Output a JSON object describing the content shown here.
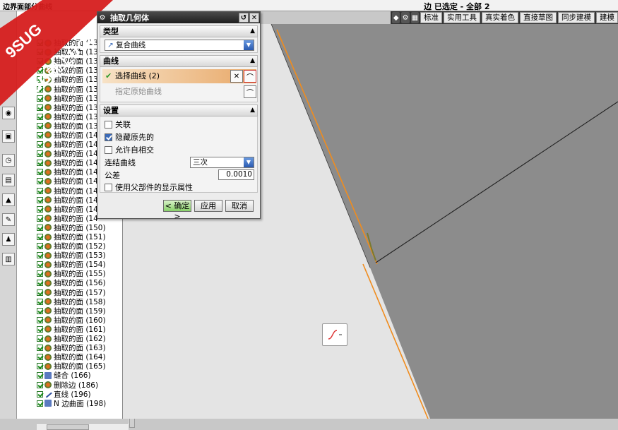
{
  "app": {
    "cut_title": "边界面部分曲线",
    "selection_status": "边 已选定 - 全部 2"
  },
  "toolbar": {
    "items": [
      "标准",
      "实用工具",
      "真实着色",
      "直接草图",
      "同步建模",
      "建模"
    ]
  },
  "watermark": {
    "brand": "9SUG",
    "slogan": "学UG就上UG网",
    "colors": {
      "ribbon": "#d61e1e",
      "text": "#ffffff"
    }
  },
  "navigator": {
    "rows": [
      {
        "label": "抽取的面 (13",
        "icon": "extract-face-icon"
      },
      {
        "label": "抽取的面 (13",
        "icon": "extract-face-icon"
      },
      {
        "label": "抽取的面 (13",
        "icon": "extract-face-icon"
      },
      {
        "label": "抽取的面 (13",
        "icon": "extract-face-icon"
      },
      {
        "label": "抽取的面 (13",
        "icon": "extract-face-icon"
      },
      {
        "label": "抽取的面 (13",
        "icon": "extract-face-icon"
      },
      {
        "label": "抽取的面 (13",
        "icon": "extract-face-icon"
      },
      {
        "label": "抽取的面 (13",
        "icon": "extract-face-icon"
      },
      {
        "label": "抽取的面 (13",
        "icon": "extract-face-icon"
      },
      {
        "label": "抽取的面 (13",
        "icon": "extract-face-icon"
      },
      {
        "label": "抽取的面 (14",
        "icon": "extract-face-icon"
      },
      {
        "label": "抽取的面 (14",
        "icon": "extract-face-icon"
      },
      {
        "label": "抽取的面 (14",
        "icon": "extract-face-icon"
      },
      {
        "label": "抽取的面 (14",
        "icon": "extract-face-icon"
      },
      {
        "label": "抽取的面 (14",
        "icon": "extract-face-icon"
      },
      {
        "label": "抽取的面 (14",
        "icon": "extract-face-icon"
      },
      {
        "label": "抽取的面 (14",
        "icon": "extract-face-icon"
      },
      {
        "label": "抽取的面 (14",
        "icon": "extract-face-icon"
      },
      {
        "label": "抽取的面 (14",
        "icon": "extract-face-icon"
      },
      {
        "label": "抽取的面 (14",
        "icon": "extract-face-icon"
      },
      {
        "label": "抽取的面 (150)",
        "icon": "extract-face-icon"
      },
      {
        "label": "抽取的面 (151)",
        "icon": "extract-face-icon"
      },
      {
        "label": "抽取的面 (152)",
        "icon": "extract-face-icon"
      },
      {
        "label": "抽取的面 (153)",
        "icon": "extract-face-icon"
      },
      {
        "label": "抽取的面 (154)",
        "icon": "extract-face-icon"
      },
      {
        "label": "抽取的面 (155)",
        "icon": "extract-face-icon"
      },
      {
        "label": "抽取的面 (156)",
        "icon": "extract-face-icon"
      },
      {
        "label": "抽取的面 (157)",
        "icon": "extract-face-icon"
      },
      {
        "label": "抽取的面 (158)",
        "icon": "extract-face-icon"
      },
      {
        "label": "抽取的面 (159)",
        "icon": "extract-face-icon"
      },
      {
        "label": "抽取的面 (160)",
        "icon": "extract-face-icon"
      },
      {
        "label": "抽取的面 (161)",
        "icon": "extract-face-icon"
      },
      {
        "label": "抽取的面 (162)",
        "icon": "extract-face-icon"
      },
      {
        "label": "抽取的面 (163)",
        "icon": "extract-face-icon"
      },
      {
        "label": "抽取的面 (164)",
        "icon": "extract-face-icon"
      },
      {
        "label": "抽取的面 (165)",
        "icon": "extract-face-icon"
      },
      {
        "label": "缝合 (166)",
        "icon": "sew-icon"
      },
      {
        "label": "删除边 (186)",
        "icon": "delete-edge-icon"
      },
      {
        "label": "直线 (196)",
        "icon": "line-icon"
      },
      {
        "label": "N 边曲面 (198)",
        "icon": "n-sided-surface-icon"
      }
    ]
  },
  "dialog": {
    "title": "抽取几何体",
    "type_section": {
      "header": "类型",
      "selected": "复合曲线"
    },
    "curve_section": {
      "header": "曲线",
      "select_curve": "选择曲线 (2)",
      "specify_original": "指定原始曲线"
    },
    "settings_section": {
      "header": "设置",
      "associative": {
        "label": "关联",
        "checked": false
      },
      "hide_original": {
        "label": "隐藏原先的",
        "checked": true
      },
      "allow_self_intersect": {
        "label": "允许自相交",
        "checked": false
      },
      "join_curves_label": "连结曲线",
      "join_curves_value": "三次",
      "tolerance_label": "公差",
      "tolerance_value": "0.0010",
      "use_parent_display": {
        "label": "使用父部件的显示属性",
        "checked": false
      }
    },
    "buttons": {
      "ok": "< 确定 >",
      "apply": "应用",
      "cancel": "取消"
    }
  },
  "viewport": {
    "colors": {
      "background": "#e6e6e6",
      "shaded_face": "#8c8c8c",
      "selected_edge": "#f08c1e",
      "edge": "#202020"
    }
  }
}
